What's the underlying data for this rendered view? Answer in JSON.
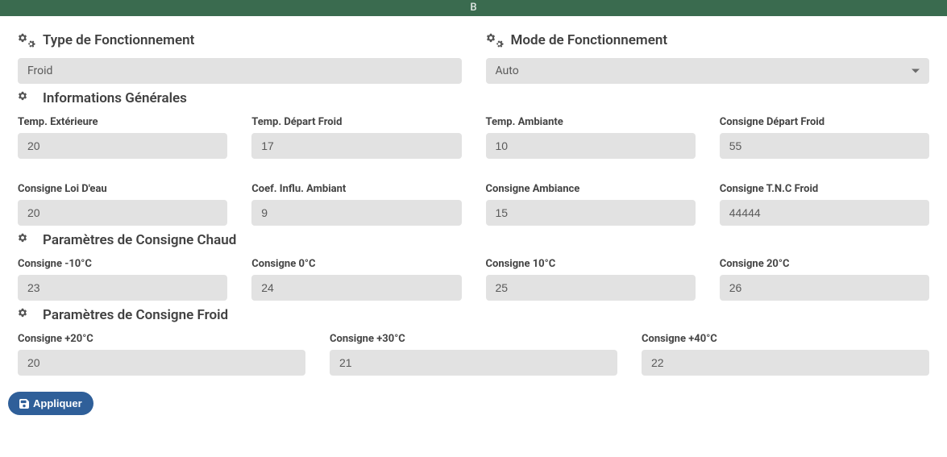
{
  "header": {
    "title": "B"
  },
  "sections": {
    "type_fonctionnement": {
      "title": "Type de Fonctionnement",
      "value": "Froid"
    },
    "mode_fonctionnement": {
      "title": "Mode de Fonctionnement",
      "value": "Auto"
    },
    "info_generales": {
      "title": "Informations Générales",
      "fields": {
        "temp_ext": {
          "label": "Temp. Extérieure",
          "value": "20"
        },
        "temp_dep_froid": {
          "label": "Temp. Départ Froid",
          "value": "17"
        },
        "temp_ambiante": {
          "label": "Temp. Ambiante",
          "value": "10"
        },
        "cons_dep_froid": {
          "label": "Consigne Départ Froid",
          "value": "55"
        },
        "cons_loi_eau": {
          "label": "Consigne Loi D'eau",
          "value": "20"
        },
        "coef_influ": {
          "label": "Coef. Influ. Ambiant",
          "value": "9"
        },
        "cons_ambiance": {
          "label": "Consigne Ambiance",
          "value": "15"
        },
        "cons_tnc_froid": {
          "label": "Consigne T.N.C Froid",
          "value": "44444"
        }
      }
    },
    "param_chaud": {
      "title": "Paramètres de Consigne Chaud",
      "fields": {
        "m10": {
          "label": "Consigne -10°C",
          "value": "23"
        },
        "p0": {
          "label": "Consigne 0°C",
          "value": "24"
        },
        "p10": {
          "label": "Consigne 10°C",
          "value": "25"
        },
        "p20": {
          "label": "Consigne 20°C",
          "value": "26"
        }
      }
    },
    "param_froid": {
      "title": "Paramètres de Consigne Froid",
      "fields": {
        "p20": {
          "label": "Consigne +20°C",
          "value": "20"
        },
        "p30": {
          "label": "Consigne +30°C",
          "value": "21"
        },
        "p40": {
          "label": "Consigne +40°C",
          "value": "22"
        }
      }
    }
  },
  "actions": {
    "apply": "Appliquer"
  }
}
